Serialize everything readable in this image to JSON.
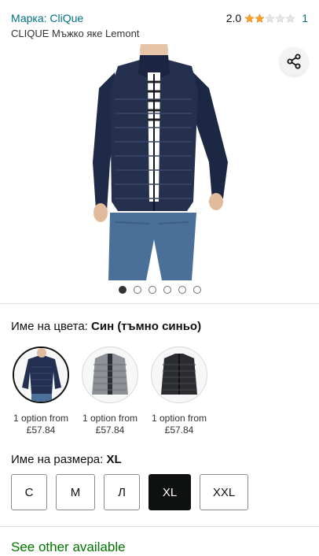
{
  "header": {
    "brand_link": "Марка: CliQue",
    "rating_score": "2.0",
    "rating_stars": 2,
    "rating_max": 5,
    "rating_count": "1",
    "product_title": "CLIQUE Мъжко яке Lemont"
  },
  "gallery": {
    "share_icon": "share-icon",
    "image_count": 6,
    "active_index": 0
  },
  "color": {
    "label": "Име на цвета:",
    "value": "Син (тъмно синьо)",
    "swatches": [
      {
        "caption_line1": "1 option from",
        "caption_line2": "£57.84",
        "tone": "navy"
      },
      {
        "caption_line1": "1 option from",
        "caption_line2": "£57.84",
        "tone": "grey"
      },
      {
        "caption_line1": "1 option from",
        "caption_line2": "£57.84",
        "tone": "black"
      }
    ]
  },
  "size": {
    "label": "Име на размера:",
    "value": "XL",
    "options": [
      "C",
      "M",
      "Л",
      "XL",
      "XXL"
    ],
    "selected": "XL"
  },
  "bottom": {
    "heading": "See other available"
  },
  "colors": {
    "link": "#007185",
    "star": "#ffa41c",
    "stock_green": "#007600"
  }
}
